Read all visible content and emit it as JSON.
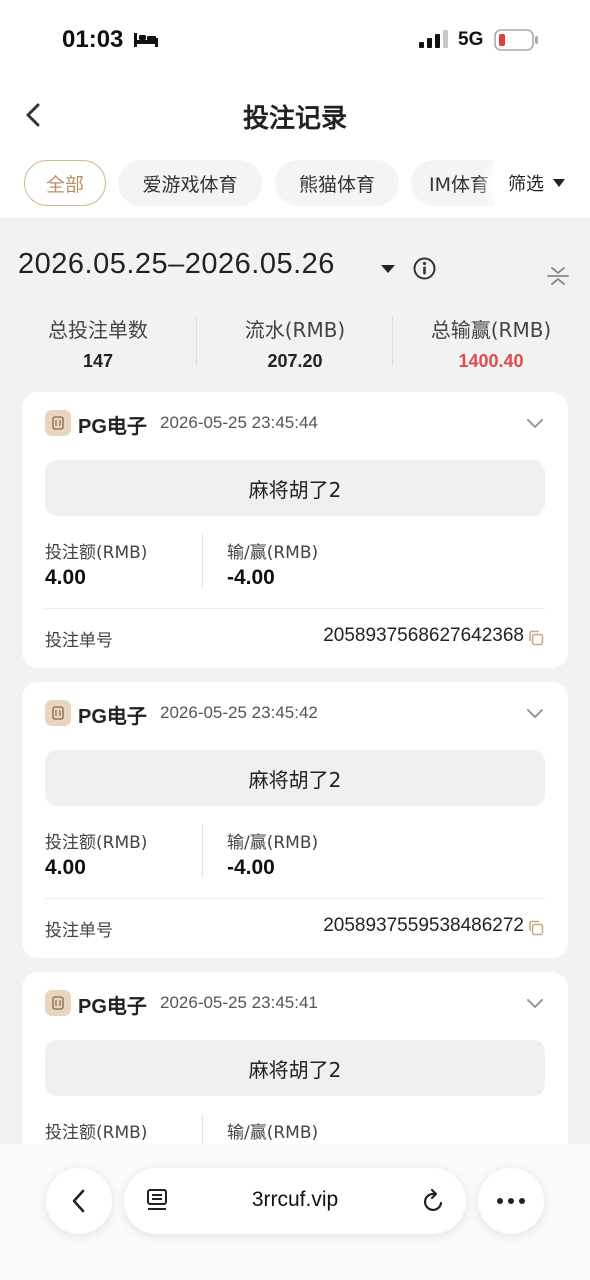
{
  "status_bar": {
    "time": "01:03",
    "network": "5G"
  },
  "header": {
    "title": "投注记录"
  },
  "tabs": [
    {
      "label": "全部",
      "active": true
    },
    {
      "label": "爱游戏体育",
      "active": false
    },
    {
      "label": "熊猫体育",
      "active": false
    },
    {
      "label": "IM体育",
      "active": false
    }
  ],
  "filter": {
    "label": "筛选"
  },
  "date_range": "2026.05.25–2026.05.26",
  "summary": [
    {
      "label": "总投注单数",
      "value": "147"
    },
    {
      "label": "流水(RMB)",
      "value": "207.20"
    },
    {
      "label": "总输赢(RMB)",
      "value": "1400.40"
    }
  ],
  "records": [
    {
      "provider": "PG电子",
      "time": "2026-05-25 23:45:44",
      "game": "麻将胡了2",
      "bet_label": "投注额(RMB)",
      "bet_amount": "4.00",
      "winloss_label": "输/赢(RMB)",
      "winloss": "-4.00",
      "order_label": "投注单号",
      "order_no": "2058937568627642368"
    },
    {
      "provider": "PG电子",
      "time": "2026-05-25 23:45:42",
      "game": "麻将胡了2",
      "bet_label": "投注额(RMB)",
      "bet_amount": "4.00",
      "winloss_label": "输/赢(RMB)",
      "winloss": "-4.00",
      "order_label": "投注单号",
      "order_no": "2058937559538486272"
    },
    {
      "provider": "PG电子",
      "time": "2026-05-25 23:45:41",
      "game": "麻将胡了2",
      "bet_label": "投注额(RMB)",
      "bet_amount": "",
      "winloss_label": "输/赢(RMB)",
      "winloss": "",
      "order_label": "",
      "order_no": ""
    }
  ],
  "browser": {
    "url": "3rrcuf.vip"
  },
  "colors": {
    "accent": "#b89368",
    "negative_total": "#e34b4b",
    "background": "#f2f2f3"
  },
  "icons": [
    "bed-icon",
    "signal-icon",
    "battery-icon",
    "back-icon",
    "caret-down-icon",
    "info-icon",
    "collapse-icon",
    "provider-icon",
    "chevron-down-icon",
    "copy-icon",
    "reader-icon",
    "reload-icon",
    "more-icon"
  ]
}
